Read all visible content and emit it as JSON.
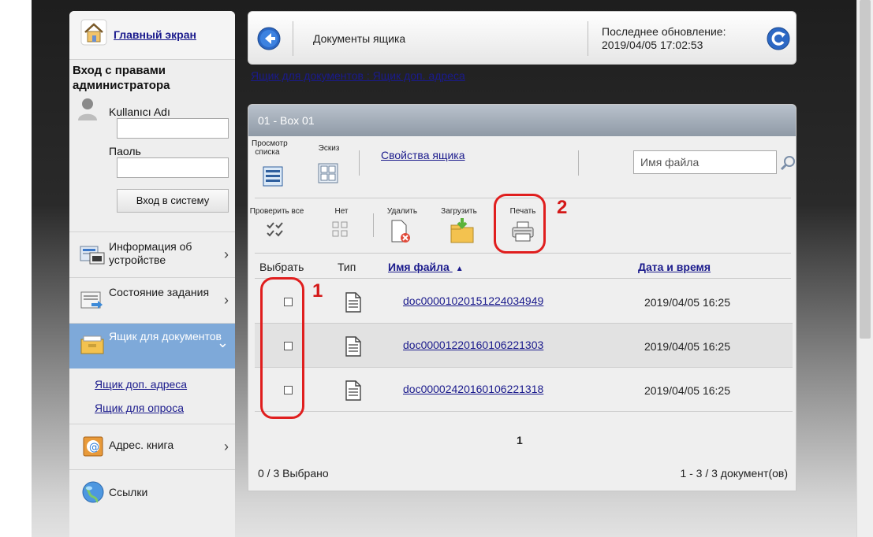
{
  "sidebar": {
    "home_label": "Главный экран",
    "admin_title": "Вход с правами администратора",
    "username_label": "Kullanıcı Adı",
    "password_label": "Паоль",
    "login_button": "Вход в систему",
    "items": [
      {
        "label": "Информация об устройстве",
        "icon": "device-info-icon"
      },
      {
        "label": "Состояние задания",
        "icon": "job-status-icon"
      },
      {
        "label": "Ящик для документов",
        "icon": "document-box-icon",
        "active": true
      },
      {
        "label": "Адрес. книга",
        "icon": "address-book-icon"
      },
      {
        "label": "Ссылки",
        "icon": "links-globe-icon"
      }
    ],
    "sub_items": [
      "Ящик доп. адреса",
      "Ящик для опроса"
    ]
  },
  "header": {
    "title": "Документы ящика",
    "last_update_label": "Последнее обновление:",
    "last_update_value": "2019/04/05 17:02:53"
  },
  "breadcrumb": "Ящик для документов : Ящик доп. адреса",
  "box": {
    "title": "01 - Box 01",
    "list_view_label": "Просмотр списка",
    "thumbnail_label": "Эскиз",
    "properties_link": "Свойства ящика",
    "search_placeholder": "Имя файла",
    "toolbar": {
      "check_all": "Проверить все",
      "none": "Нет",
      "delete": "Удалить",
      "upload": "Загрузить",
      "print": "Печать"
    },
    "columns": {
      "select": "Выбрать",
      "type": "Тип",
      "filename": "Имя файла",
      "datetime": "Дата и время"
    },
    "files": [
      {
        "name": "doc00001020151224034949",
        "date": "2019/04/05 16:25"
      },
      {
        "name": "doc00001220160106221303",
        "date": "2019/04/05 16:25"
      },
      {
        "name": "doc00002420160106221318",
        "date": "2019/04/05 16:25"
      }
    ],
    "page": "1",
    "selected_status": "0 / 3 Выбрано",
    "range_status": "1 - 3 / 3 документ(ов)"
  },
  "annotations": {
    "callout_1": "1",
    "callout_2": "2",
    "color": "#e01e1e"
  }
}
